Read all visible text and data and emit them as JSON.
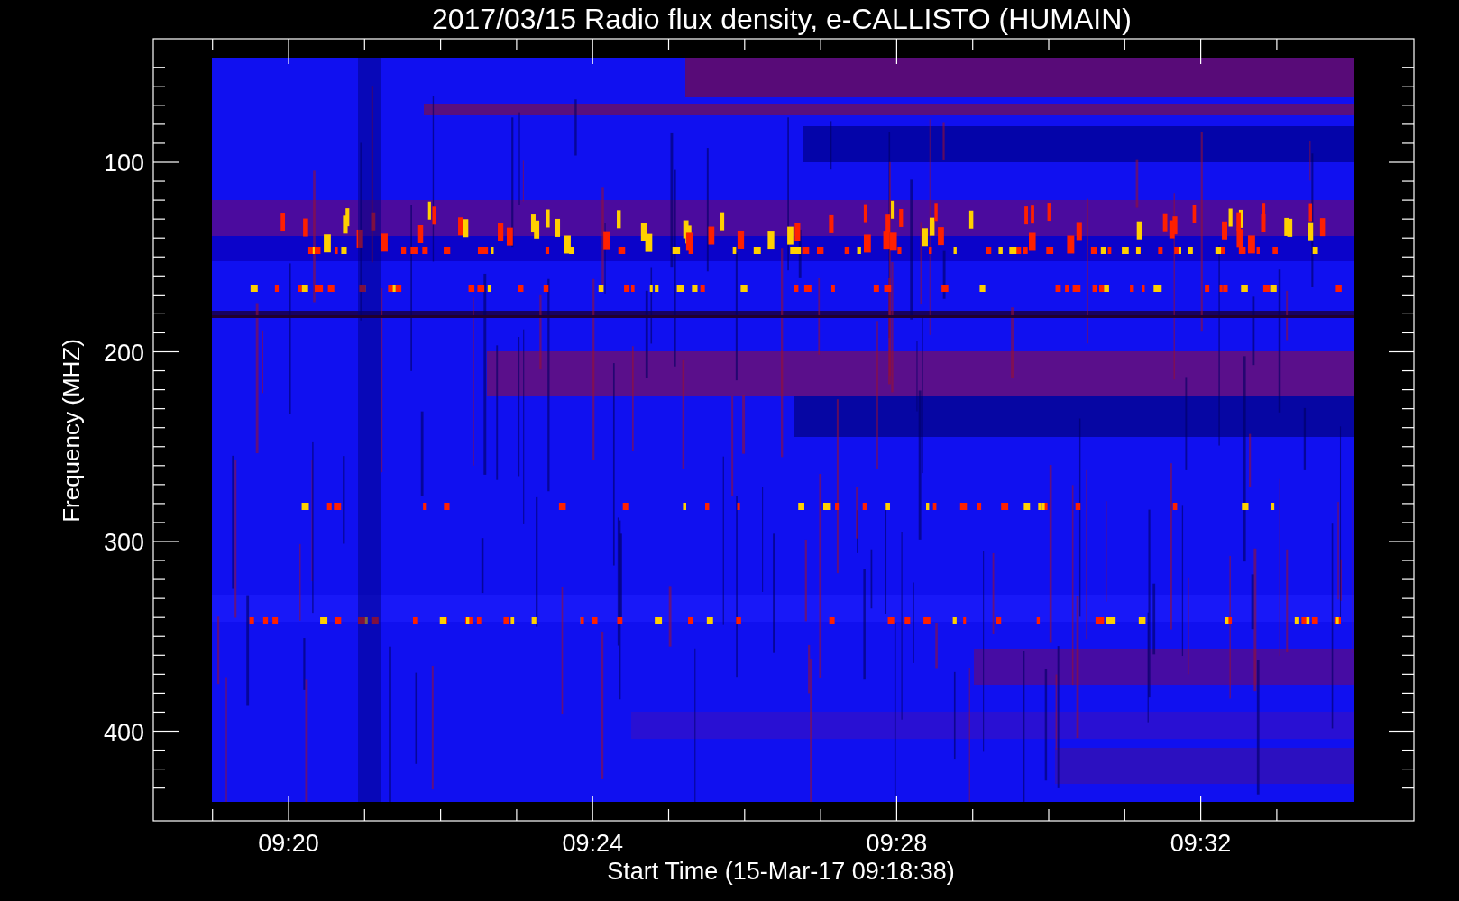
{
  "title": "2017/03/15  Radio flux density, e-CALLISTO (HUMAIN)",
  "y_axis": {
    "label": "Frequency (MHZ)",
    "ticks": [
      "100",
      "200",
      "300",
      "400"
    ]
  },
  "x_axis": {
    "label": "Start Time (15-Mar-17 09:18:38)",
    "ticks": [
      "09:20",
      "09:24",
      "09:28",
      "09:32"
    ]
  }
}
